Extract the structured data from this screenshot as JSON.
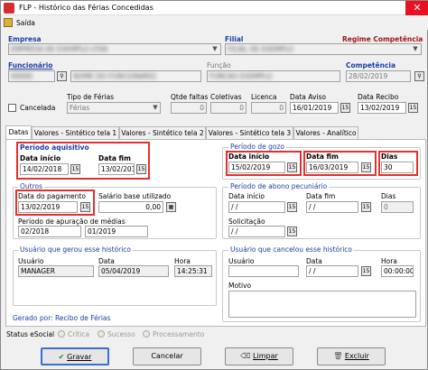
{
  "window": {
    "title": "FLP - Histórico das Férias Concedidas",
    "close": "✕"
  },
  "menu": {
    "saida": "Saída"
  },
  "header": {
    "empresa_label": "Empresa",
    "empresa_value": "EMPRESA DE EXEMPLO LTDA",
    "filial_label": "Filial",
    "filial_value": "FILIAL DE EXEMPLO",
    "regime_label": "Regime Competência",
    "funcionario_label": "Funcionário",
    "funcionario_code": "00000",
    "funcionario_name": "NOME DO FUNCIONARIO",
    "funcao_label": "Função",
    "funcao_value": "FUNCAO EXEMPLO",
    "competencia_label": "Competência",
    "competencia_value": "28/02/2019",
    "cancelada_label": "Cancelada",
    "tipo_ferias_label": "Tipo de Férias",
    "tipo_ferias_value": "Férias",
    "qtde_faltas_label": "Qtde faltas",
    "qtde_faltas_value": "0",
    "coletivas_label": "Coletivas",
    "coletivas_value": "0",
    "licenca_label": "Licenca",
    "licenca_value": "0",
    "data_aviso_label": "Data Aviso",
    "data_aviso_value": "16/01/2019",
    "data_recibo_label": "Data Recibo",
    "data_recibo_value": "13/02/2019"
  },
  "tabs": [
    "Datas",
    "Valores - Sintético tela 1",
    "Valores - Sintético tela 2",
    "Valores - Sintético tela 3",
    "Valores - Analítico"
  ],
  "datas": {
    "aquisitivo_title": "Período aquisitivo",
    "aquisitivo_inicio_label": "Data início",
    "aquisitivo_inicio": "14/02/2018",
    "aquisitivo_fim_label": "Data fim",
    "aquisitivo_fim": "13/02/2019",
    "gozo_title": "Período de gozo",
    "gozo_inicio_label": "Data início",
    "gozo_inicio": "15/02/2019",
    "gozo_fim_label": "Data fim",
    "gozo_fim": "16/03/2019",
    "dias_label": "Dias",
    "dias": "30",
    "outros_title": "Outros",
    "pagamento_label": "Data do pagamento",
    "pagamento": "13/02/2019",
    "salario_label": "Salário base utilizado",
    "salario": "0,00",
    "apuracao_label": "Período de apuração de médias",
    "apuracao_de": "02/2018",
    "apuracao_ate": "01/2019",
    "abono_title": "Período de abono pecuniário",
    "abono_inicio_label": "Data início",
    "abono_inicio": " / /",
    "abono_fim_label": "Data fim",
    "abono_fim": " / /",
    "abono_dias_label": "Dias",
    "abono_dias": "0",
    "solicitacao_label": "Solicitação",
    "solicitacao": " / /",
    "usuario_gerou_title": "Usuário que gerou esse histórico",
    "ug_usuario_label": "Usuário",
    "ug_usuario": "MANAGER",
    "ug_data_label": "Data",
    "ug_data": "05/04/2019",
    "ug_hora_label": "Hora",
    "ug_hora": "14:25:31",
    "usuario_cancelou_title": "Usuário que cancelou esse histórico",
    "uc_usuario_label": "Usuário",
    "uc_usuario": "",
    "uc_data_label": "Data",
    "uc_data": " / /",
    "uc_hora_label": "Hora",
    "uc_hora": "00:00:00",
    "motivo_label": "Motivo",
    "gerado_por": "Gerado por: Recibo de Férias"
  },
  "status": {
    "label": "Status eSocial",
    "options": [
      "Crítica",
      "Sucesso",
      "Processamento"
    ]
  },
  "buttons": {
    "gravar": "Gravar",
    "cancelar": "Cancelar",
    "limpar": "Limpar",
    "excluir": "Excluir"
  },
  "colors": {
    "highlight": "#e53030",
    "label_blue": "#1a3fa8",
    "regime_red": "#a01818"
  }
}
